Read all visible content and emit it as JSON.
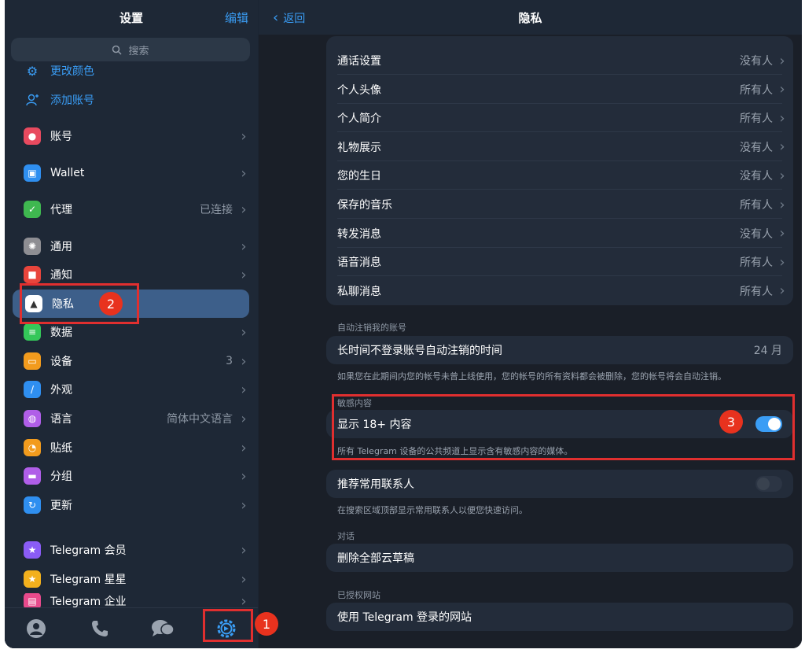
{
  "left": {
    "title": "设置",
    "edit_label": "编辑",
    "search_placeholder": "搜索",
    "top_items": [
      {
        "label": "更改颜色",
        "icon": "palette-icon"
      },
      {
        "label": "添加账号",
        "icon": "add-user-icon"
      }
    ],
    "items": [
      {
        "label": "账号",
        "value": "",
        "icon": "account-icon",
        "color": "#e84a5f"
      },
      {
        "label": "Wallet",
        "value": "",
        "icon": "wallet-icon",
        "color": "#2f8ff0"
      },
      {
        "label": "代理",
        "value": "已连接",
        "icon": "shield-icon",
        "color": "#3fb850"
      },
      {
        "label": "通用",
        "value": "",
        "icon": "gear-icon",
        "color": "#8e8e93"
      },
      {
        "label": "通知",
        "value": "",
        "icon": "notification-icon",
        "color": "#e8453c"
      },
      {
        "label": "隐私",
        "value": "",
        "icon": "lock-icon",
        "color": "#ffffff"
      },
      {
        "label": "数据",
        "value": "",
        "icon": "database-icon",
        "color": "#34c759"
      },
      {
        "label": "设备",
        "value": "3",
        "icon": "laptop-icon",
        "color": "#f29b1d"
      },
      {
        "label": "外观",
        "value": "",
        "icon": "brush-icon",
        "color": "#2f8ff0"
      },
      {
        "label": "语言",
        "value": "简体中文语言",
        "icon": "globe-icon",
        "color": "#b05ee8"
      },
      {
        "label": "贴纸",
        "value": "",
        "icon": "sticker-icon",
        "color": "#f29b1d"
      },
      {
        "label": "分组",
        "value": "",
        "icon": "folder-icon",
        "color": "#b05ee8"
      },
      {
        "label": "更新",
        "value": "",
        "icon": "refresh-icon",
        "color": "#2f8ff0"
      },
      {
        "label": "Telegram 会员",
        "value": "",
        "icon": "premium-star-icon",
        "color": "#8a5cf5"
      },
      {
        "label": "Telegram 星星",
        "value": "",
        "icon": "star-icon",
        "color": "#f2b01d"
      },
      {
        "label": "Telegram 企业",
        "value": "",
        "icon": "business-icon",
        "color": "#e84a8c"
      }
    ],
    "tabs": [
      "contacts-tab",
      "calls-tab",
      "chats-tab",
      "settings-tab"
    ]
  },
  "right": {
    "back_label": "返回",
    "title": "隐私",
    "privacy_rows": [
      {
        "label": "通话设置",
        "value": "没有人"
      },
      {
        "label": "个人头像",
        "value": "所有人"
      },
      {
        "label": "个人简介",
        "value": "所有人"
      },
      {
        "label": "礼物展示",
        "value": "没有人"
      },
      {
        "label": "您的生日",
        "value": "没有人"
      },
      {
        "label": "保存的音乐",
        "value": "所有人"
      },
      {
        "label": "转发消息",
        "value": "没有人"
      },
      {
        "label": "语音消息",
        "value": "所有人"
      },
      {
        "label": "私聊消息",
        "value": "所有人"
      }
    ],
    "auto_delete": {
      "section": "自动注销我的账号",
      "label": "长时间不登录账号自动注销的时间",
      "value": "24 月",
      "footnote": "如果您在此期间内您的帐号未曾上线使用，您的帐号的所有资料都会被删除，您的帐号将会自动注销。"
    },
    "sensitive": {
      "section": "敏感内容",
      "label": "显示 18+ 内容",
      "enabled": true,
      "footnote": "所有 Telegram 设备的公共频道上显示含有敏感内容的媒体。"
    },
    "contacts": {
      "label": "推荐常用联系人",
      "enabled": false,
      "footnote": "在搜索区域顶部显示常用联系人以便您快速访问。"
    },
    "chats": {
      "section": "对话",
      "label": "删除全部云草稿"
    },
    "websites": {
      "section": "已授权网站",
      "label": "使用 Telegram 登录的网站"
    }
  },
  "annotations": {
    "badge1": "1",
    "badge2": "2",
    "badge3": "3"
  },
  "colors": {
    "accent": "#3a9df5",
    "annotation": "#e02f2f"
  }
}
